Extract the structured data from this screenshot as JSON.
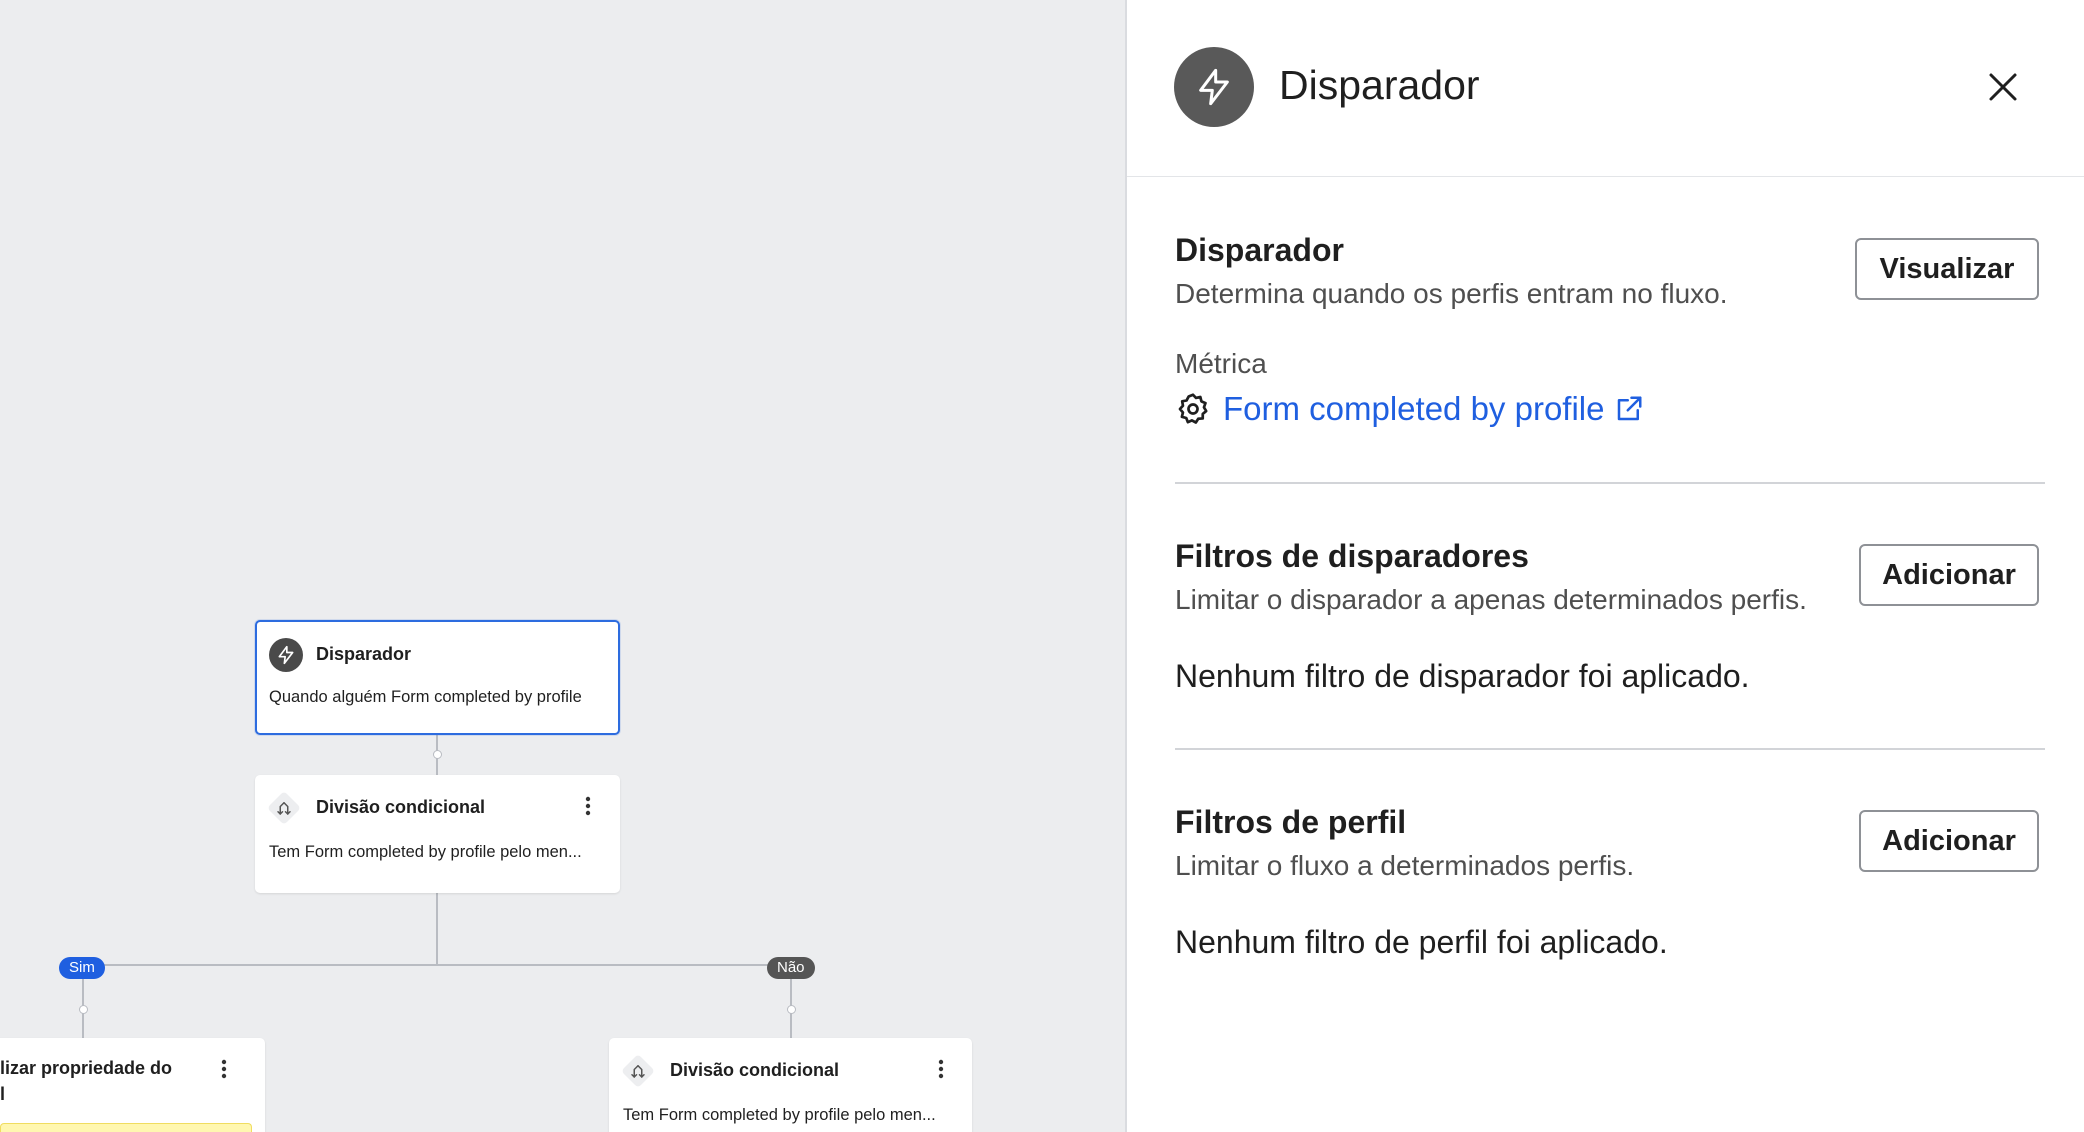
{
  "canvas": {
    "trigger_node": {
      "title": "Disparador",
      "body": "Quando alguém Form completed by profile",
      "icon": "lightning-icon"
    },
    "split_node_1": {
      "title": "Divisão condicional",
      "body": "Tem Form completed by profile pelo men...",
      "icon": "split-icon"
    },
    "branch_yes": "Sim",
    "branch_no": "Não",
    "left_node": {
      "title_line1": "lizar propriedade do",
      "title_line2": "l"
    },
    "split_node_2": {
      "title": "Divisão condicional",
      "body": "Tem Form completed by profile pelo men...",
      "icon": "split-icon"
    }
  },
  "panel": {
    "header_title": "Disparador",
    "trigger_section": {
      "title": "Disparador",
      "description": "Determina quando os perfis entram no fluxo.",
      "button": "Visualizar",
      "metric_label": "Métrica",
      "metric_value": "Form completed by profile"
    },
    "trigger_filters": {
      "title": "Filtros de disparadores",
      "description": "Limitar o disparador a apenas determinados perfis.",
      "button": "Adicionar",
      "empty": "Nenhum filtro de disparador foi aplicado."
    },
    "profile_filters": {
      "title": "Filtros de perfil",
      "description": "Limitar o fluxo a determinados perfis.",
      "button": "Adicionar",
      "empty": "Nenhum filtro de perfil foi aplicado."
    }
  },
  "colors": {
    "canvas_bg": "#ECEDEF",
    "accent_blue": "#1F5FE0",
    "selected_border": "#2D6CDF",
    "dark_icon": "#4A4A4A"
  }
}
